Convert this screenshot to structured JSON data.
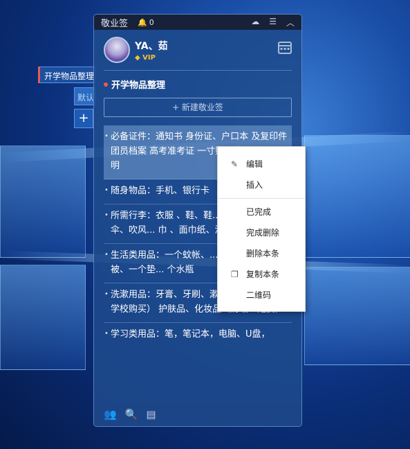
{
  "side_tabs": {
    "active": "开学物品整理",
    "default": "默认",
    "add": "+"
  },
  "titlebar": {
    "app_name": "敬业签",
    "notification_count": "0"
  },
  "profile": {
    "name": "YA、茹",
    "vip": "VIP"
  },
  "list": {
    "title": "开学物品整理",
    "new_button": "+ 新建敬业签",
    "items": [
      "必备证件：通知书  身份证、户口本 及复印件  团员档案  高考准考证  一寸照片若干  贫困证明",
      "随身物品：手机、银行卡",
      "所需行李：衣服 、鞋、鞋... 服及解放鞋、雨伞、吹风... 巾 、面巾纸、湿巾，卷纸",
      "生活类用品：一个蚊帐、... 枕芯、两个盖被、一个垫... 个水瓶",
      "洗漱用品：牙膏、牙刷、漱口杯（也可以在学校购买） 护肤品、化妆品（防晒一定要）",
      "学习类用品：笔，笔记本，电脑、U盘，"
    ]
  },
  "context_menu": [
    "编辑",
    "插入",
    "已完成",
    "完成删除",
    "删除本条",
    "复制本条",
    "二维码"
  ],
  "colors": {
    "accent_red": "#ec5b4b",
    "vip_gold": "#f4c230",
    "titlebar_bg": "#17213a"
  }
}
